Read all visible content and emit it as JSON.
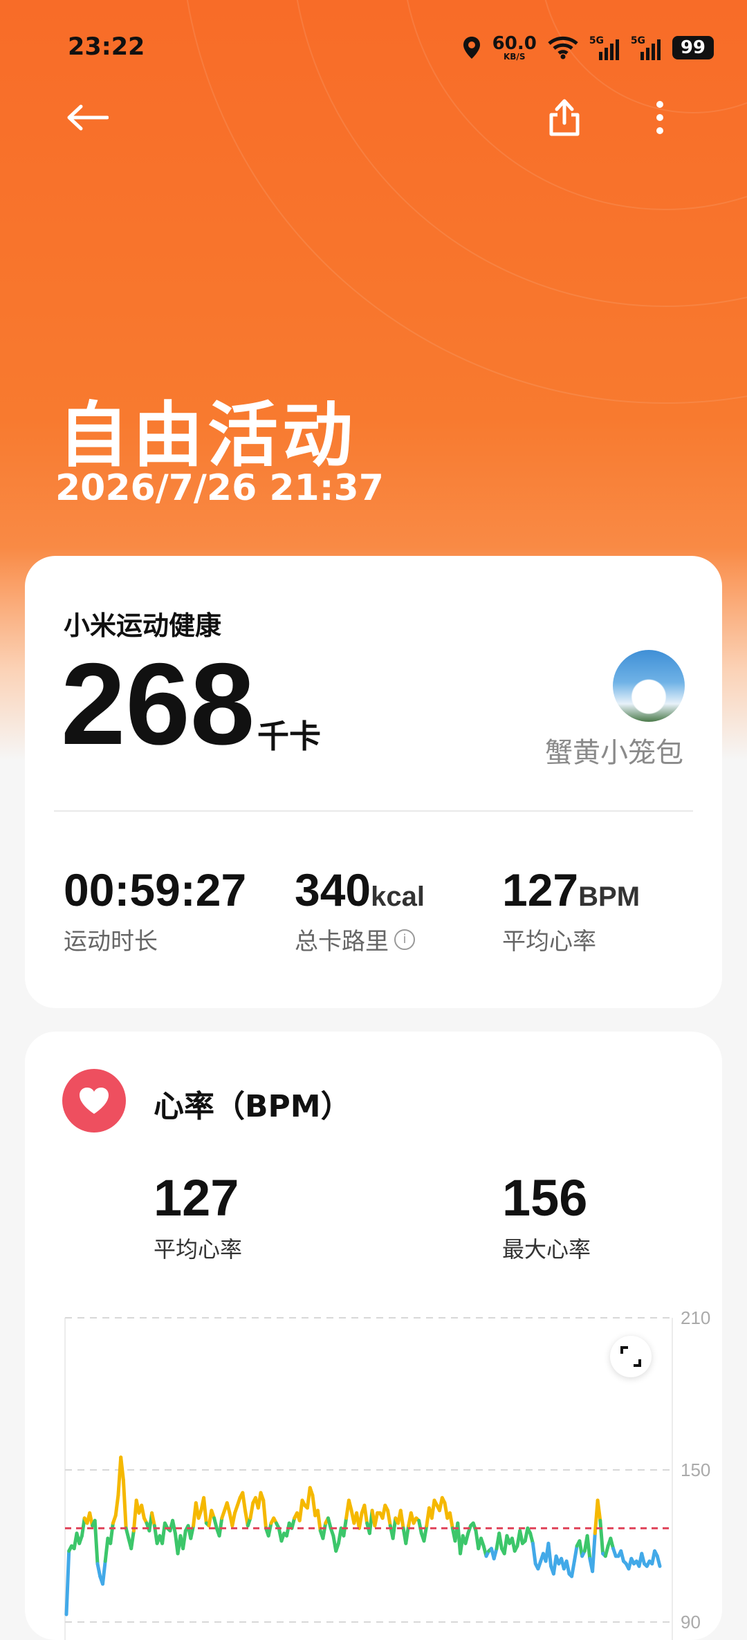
{
  "status_bar": {
    "time": "23:22",
    "net_speed_value": "60.0",
    "net_speed_unit": "KB/S",
    "signal1_label": "5G",
    "signal2_label": "5G",
    "battery": "99",
    "icons": [
      "location-icon",
      "wifi-icon",
      "signal-icon",
      "signal-icon",
      "battery-icon"
    ]
  },
  "topbar": {
    "icons": [
      "back-arrow-icon",
      "share-icon",
      "more-vertical-icon"
    ]
  },
  "hero": {
    "title": "自由活动",
    "datetime": "2026/7/26 21:37"
  },
  "summary_card": {
    "app_name": "小米运动健康",
    "calories_value": "268",
    "calories_unit": "千卡",
    "username": "蟹黄小笼包",
    "stats": [
      {
        "value": "00:59:27",
        "unit": "",
        "label": "运动时长"
      },
      {
        "value": "340",
        "unit": "kcal",
        "label": "总卡路里"
      },
      {
        "value": "127",
        "unit": "BPM",
        "label": "平均心率"
      }
    ]
  },
  "heart_card": {
    "title": "心率（BPM）",
    "avg_value": "127",
    "avg_label": "平均心率",
    "max_value": "156",
    "max_label": "最大心率"
  },
  "colors": {
    "hero_orange": "#f86c28",
    "heart_red": "#ee4f5f",
    "line_blue": "#42a9e8",
    "line_green": "#3cc66a",
    "line_yellow": "#f5b800",
    "avg_line": "#e0455b"
  },
  "chart_data": {
    "type": "line",
    "title": "",
    "ylim": [
      90,
      210
    ],
    "y_ticks": [
      "210",
      "150",
      "90"
    ],
    "average": 127,
    "grid": true,
    "values": [
      93,
      118,
      120,
      119,
      125,
      121,
      124,
      131,
      129,
      133,
      128,
      130,
      113,
      108,
      105,
      114,
      123,
      121,
      129,
      132,
      140,
      155,
      146,
      127,
      123,
      119,
      126,
      138,
      133,
      136,
      131,
      129,
      126,
      133,
      128,
      121,
      124,
      121,
      129,
      127,
      126,
      130,
      125,
      117,
      124,
      119,
      126,
      128,
      123,
      128,
      137,
      131,
      134,
      139,
      129,
      128,
      134,
      131,
      127,
      124,
      131,
      134,
      137,
      133,
      128,
      133,
      136,
      139,
      141,
      134,
      128,
      131,
      137,
      139,
      135,
      141,
      138,
      127,
      124,
      129,
      131,
      129,
      127,
      122,
      125,
      124,
      129,
      127,
      131,
      133,
      130,
      138,
      136,
      135,
      143,
      140,
      132,
      134,
      126,
      123,
      129,
      131,
      127,
      124,
      118,
      121,
      127,
      124,
      131,
      138,
      134,
      129,
      133,
      127,
      133,
      136,
      129,
      125,
      134,
      128,
      133,
      133,
      131,
      136,
      134,
      128,
      123,
      131,
      129,
      134,
      127,
      121,
      128,
      133,
      129,
      131,
      130,
      125,
      122,
      128,
      135,
      131,
      138,
      136,
      134,
      139,
      137,
      131,
      133,
      127,
      122,
      129,
      117,
      124,
      121,
      125,
      128,
      129,
      126,
      119,
      123,
      120,
      116,
      118,
      119,
      115,
      119,
      125,
      119,
      117,
      124,
      121,
      123,
      118,
      120,
      126,
      121,
      122,
      127,
      125,
      121,
      113,
      111,
      114,
      117,
      114,
      121,
      112,
      109,
      116,
      113,
      115,
      111,
      114,
      109,
      108,
      114,
      120,
      122,
      116,
      118,
      124,
      115,
      110,
      125,
      138,
      130,
      117,
      116,
      120,
      123,
      119,
      116,
      116,
      118,
      114,
      113,
      111,
      115,
      113,
      114,
      112,
      117,
      113,
      112,
      114,
      113,
      118,
      116,
      112
    ]
  }
}
